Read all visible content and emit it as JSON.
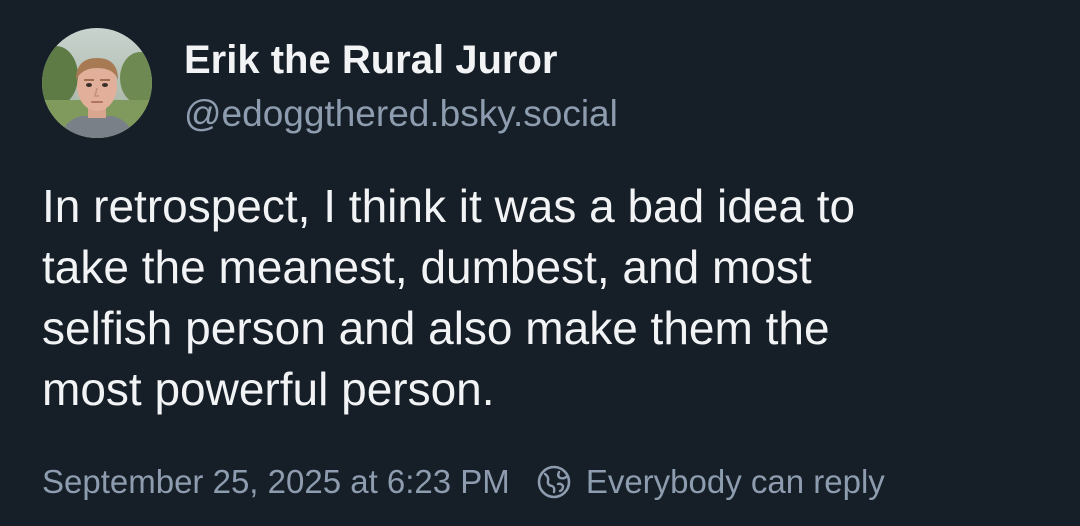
{
  "post": {
    "author": {
      "display_name": "Erik the Rural Juror",
      "handle": "@edoggthered.bsky.social",
      "avatar_icon": "avatar-photo"
    },
    "text_lines": [
      "In retrospect, I think it was a bad idea to",
      "take the meanest, dumbest, and most",
      "selfish person and also make them the",
      "most powerful person."
    ],
    "timestamp": "September 25, 2025 at 6:23 PM",
    "reply_setting": {
      "icon": "globe-icon",
      "label": "Everybody can reply"
    }
  },
  "colors": {
    "background": "#161e27",
    "primary_text": "#f1f3f5",
    "secondary_text": "#8d9cae"
  }
}
